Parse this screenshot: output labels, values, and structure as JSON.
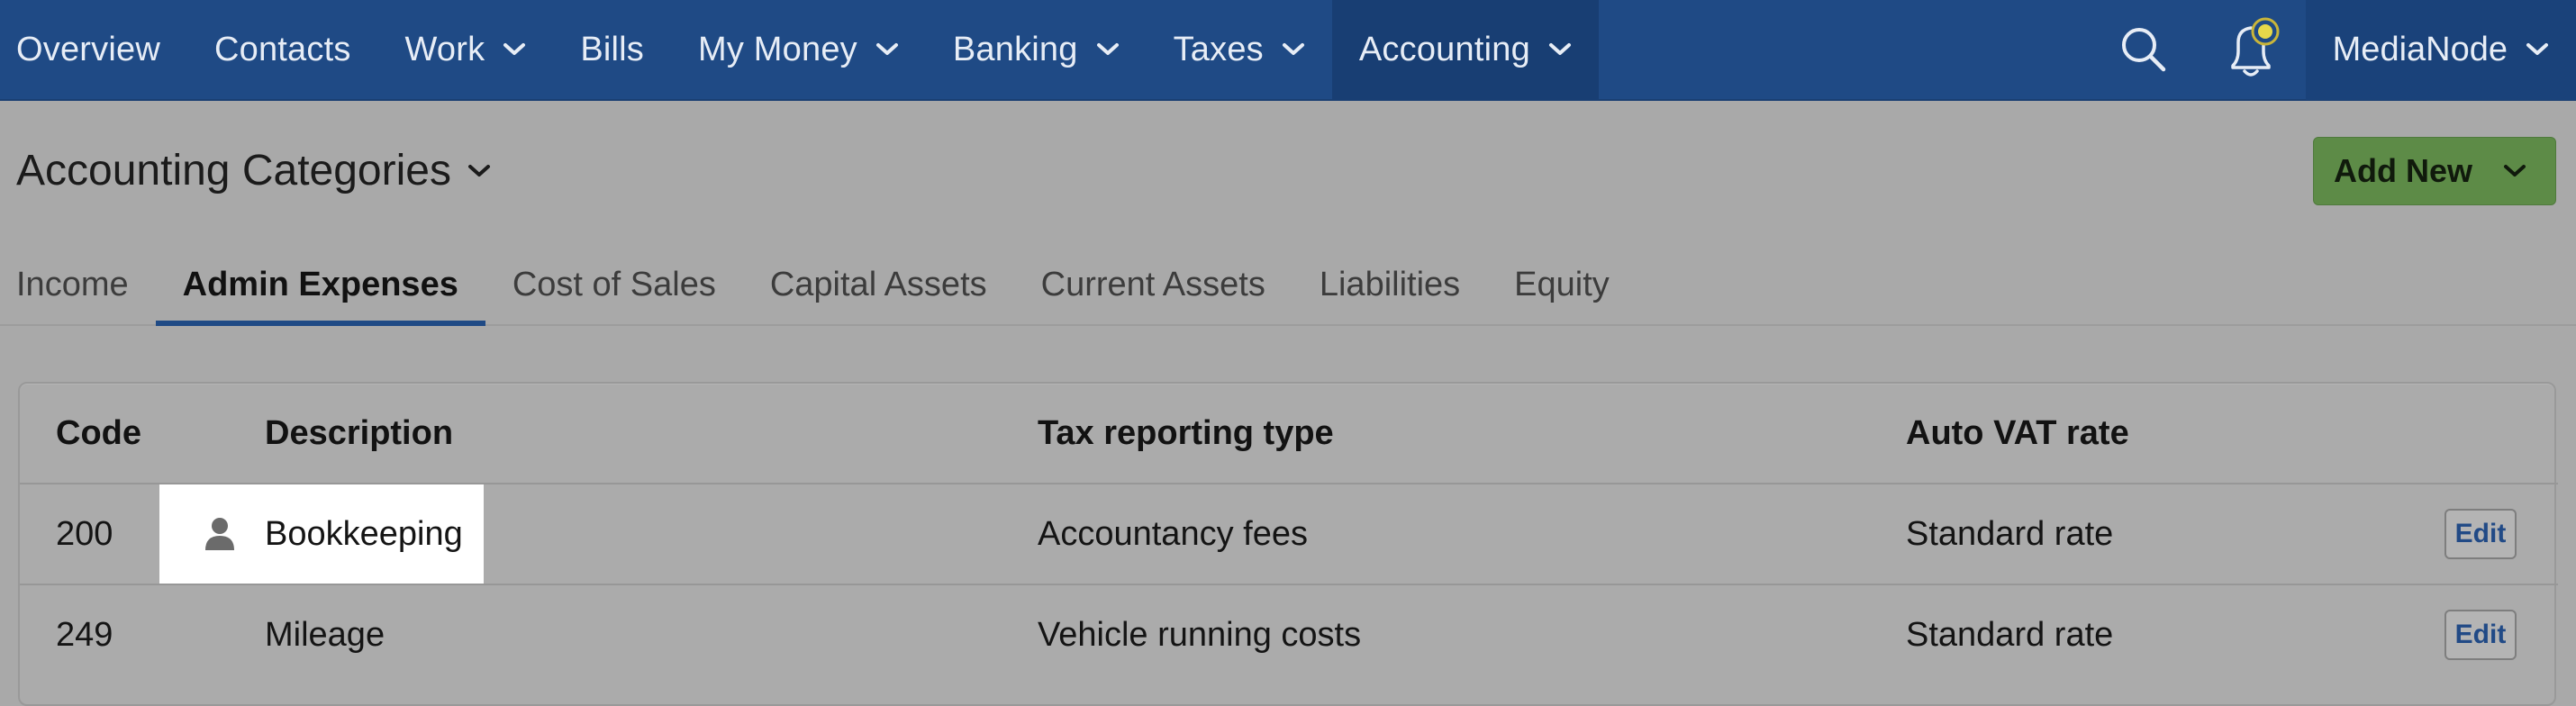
{
  "nav": {
    "items": [
      {
        "label": "Overview",
        "dropdown": false
      },
      {
        "label": "Contacts",
        "dropdown": false
      },
      {
        "label": "Work",
        "dropdown": true
      },
      {
        "label": "Bills",
        "dropdown": false
      },
      {
        "label": "My Money",
        "dropdown": true
      },
      {
        "label": "Banking",
        "dropdown": true
      },
      {
        "label": "Taxes",
        "dropdown": true
      },
      {
        "label": "Accounting",
        "dropdown": true,
        "active": true
      }
    ],
    "search_icon": "search-icon",
    "notification_icon": "bell-icon",
    "user": "MediaNode"
  },
  "header": {
    "title": "Accounting Categories",
    "add_new": "Add New"
  },
  "tabs": [
    {
      "label": "Income"
    },
    {
      "label": "Admin Expenses",
      "active": true
    },
    {
      "label": "Cost of Sales"
    },
    {
      "label": "Capital Assets"
    },
    {
      "label": "Current Assets"
    },
    {
      "label": "Liabilities"
    },
    {
      "label": "Equity"
    }
  ],
  "table": {
    "columns": [
      "Code",
      "Description",
      "Tax reporting type",
      "Auto VAT rate"
    ],
    "rows": [
      {
        "code": "200",
        "description": "Bookkeeping",
        "tax_type": "Accountancy fees",
        "vat": "Standard rate",
        "edit": "Edit",
        "user_icon": true
      },
      {
        "code": "249",
        "description": "Mileage",
        "tax_type": "Vehicle running costs",
        "vat": "Standard rate",
        "edit": "Edit",
        "user_icon": false
      }
    ]
  },
  "colors": {
    "nav_bg": "#1f4a85",
    "accent_green": "#5d8b47",
    "page_bg": "#a9a9a9",
    "highlight": "#ffffff"
  }
}
